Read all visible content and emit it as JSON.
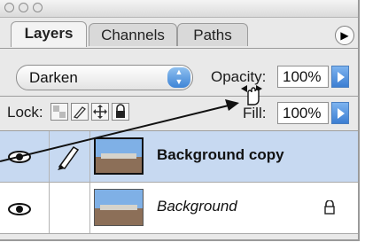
{
  "tabs": [
    {
      "label": "Layers",
      "active": true
    },
    {
      "label": "Channels",
      "active": false
    },
    {
      "label": "Paths",
      "active": false
    }
  ],
  "blend_mode": {
    "value": "Darken"
  },
  "opacity": {
    "label": "Opacity:",
    "value": "100%"
  },
  "lock": {
    "label": "Lock:"
  },
  "fill": {
    "label": "Fill:",
    "value": "100%"
  },
  "layers": [
    {
      "name": "Background copy",
      "selected": true,
      "visible": true,
      "linked_brush": true
    },
    {
      "name": "Background",
      "selected": false,
      "visible": true,
      "locked": true
    }
  ],
  "colors": {
    "selected_row": "#c7d9f1",
    "accent_blue": "#3c7ed2"
  },
  "icons": [
    "eye-icon",
    "brush-icon",
    "lock-icon",
    "panel-menu-icon",
    "transparency-lock-icon",
    "move-lock-icon",
    "hand-scrub-cursor-icon"
  ]
}
